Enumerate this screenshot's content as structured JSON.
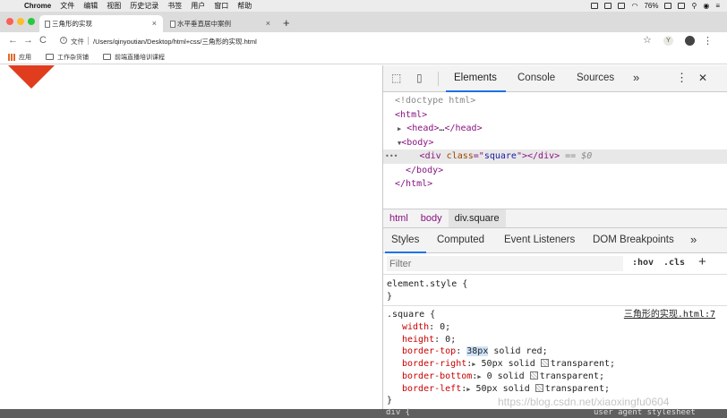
{
  "menubar": {
    "apple": "",
    "items": [
      "Chrome",
      "文件",
      "编辑",
      "视图",
      "历史记录",
      "书签",
      "用户",
      "窗口",
      "帮助"
    ],
    "battery": "76%"
  },
  "tabs": [
    {
      "title": "三角形的实现",
      "close": "×"
    },
    {
      "title": "水平垂直居中案例",
      "close": "×"
    }
  ],
  "new_tab": "+",
  "address": {
    "back": "←",
    "forward": "→",
    "reload": "C",
    "info": "i",
    "scheme_label": "文件",
    "url": "/Users/qinyoutian/Desktop/html+css/三角形的实现.html",
    "star": "☆",
    "ext": "Y",
    "menu": "⋮"
  },
  "bookmarks": [
    "应用",
    "工作杂货铺",
    "前端直播培训课程"
  ],
  "colors": {
    "triangle": "#e03c1e",
    "accent": "#1a73e8"
  },
  "devtools": {
    "tabs": [
      "Elements",
      "Console",
      "Sources"
    ],
    "more": "»",
    "menu": "⋮",
    "close": "✕",
    "dom": {
      "doctype": "<!doctype html>",
      "html_open": "html",
      "head": "head",
      "body_open": "body",
      "div_tag": "div",
      "div_attr": "class",
      "div_value": "square",
      "eq_marker": " == $0",
      "ellipsis": "•••"
    },
    "breadcrumbs": [
      "html",
      "body",
      "div.square"
    ],
    "subtabs": [
      "Styles",
      "Computed",
      "Event Listeners",
      "DOM Breakpoints"
    ],
    "subtabs_more": "»",
    "filter_placeholder": "Filter",
    "hov": ":hov",
    "cls": ".cls",
    "plus": "+",
    "element_style": "element.style {",
    "close_brace": "}",
    "rule": {
      "selector": ".square {",
      "source": "三角形的实现.html:7",
      "width_prop": "width",
      "width_val": "0;",
      "height_prop": "height",
      "height_val": "0;",
      "bt_prop": "border-top",
      "bt_hl": "38px",
      "bt_rest": " solid red;",
      "br_prop": "border-right",
      "br_val": "50px solid ",
      "br_color": "transparent;",
      "bb_prop": "border-bottom",
      "bb_val": "0 solid ",
      "bb_color": "transparent;",
      "bl_prop": "border-left",
      "bl_val": "50px solid ",
      "bl_color": "transparent;"
    },
    "peek_left": "div {",
    "peek_right": "user agent stylesheet"
  },
  "watermark": "https://blog.csdn.net/xiaoxingfu0604"
}
